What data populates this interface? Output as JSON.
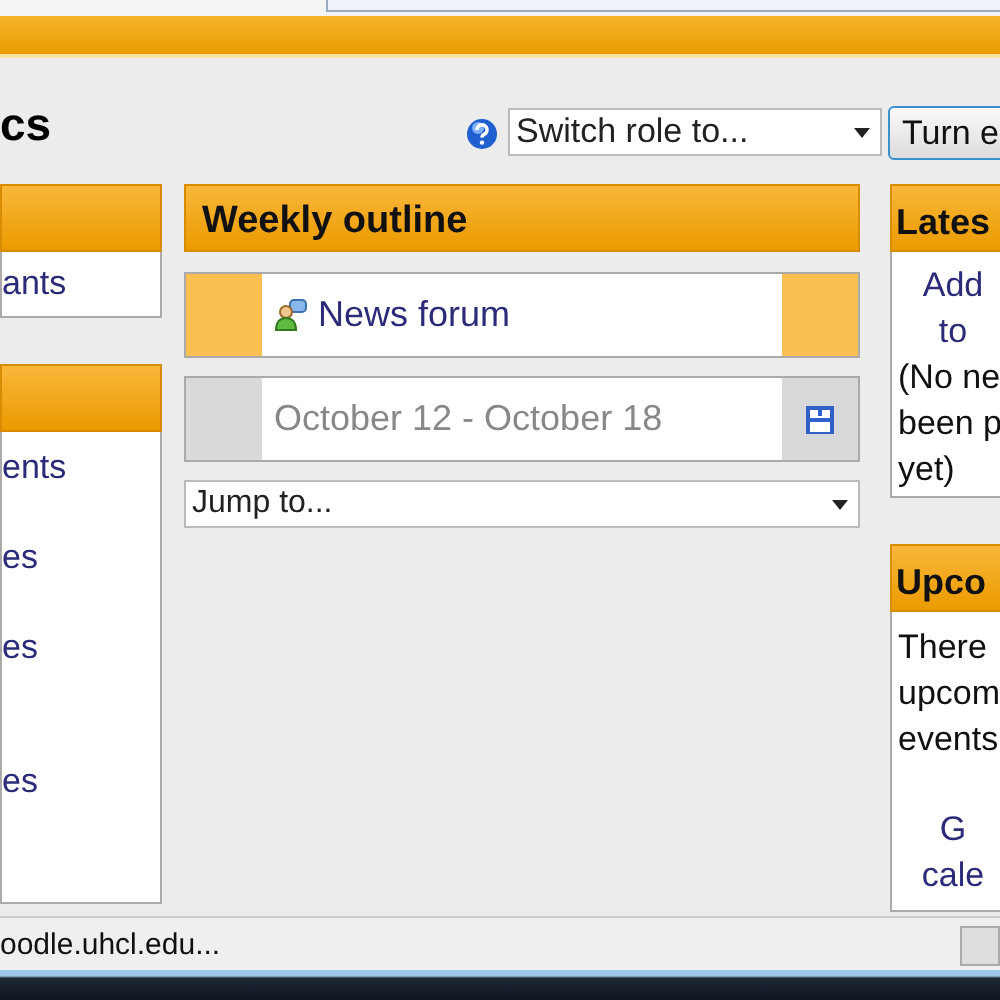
{
  "course_title": "cs",
  "role_select": {
    "value": "Switch role to..."
  },
  "edit_button": {
    "label": "Turn e"
  },
  "left_blocks": [
    {
      "items": [
        "ants"
      ]
    },
    {
      "items": [
        "ents",
        "es",
        "es",
        "es"
      ]
    }
  ],
  "center": {
    "title": "Weekly outline",
    "sections": [
      {
        "kind": "forum",
        "label": "News forum",
        "highlighted": true
      },
      {
        "kind": "week",
        "label": "October 12 - October 18",
        "highlighted": false
      }
    ],
    "jump_select": {
      "value": "Jump to..."
    }
  },
  "right_blocks": [
    {
      "title_lines": [
        "Lates"
      ],
      "lines": [
        {
          "kind": "link",
          "text": "Add"
        },
        {
          "kind": "link",
          "text": "to"
        },
        {
          "kind": "text",
          "text": "(No ne"
        },
        {
          "kind": "text",
          "text": "been p"
        },
        {
          "kind": "text",
          "text": "yet)"
        }
      ]
    },
    {
      "title_lines": [
        "Upco"
      ],
      "lines": [
        {
          "kind": "text",
          "text": "There"
        },
        {
          "kind": "text",
          "text": "upcom"
        },
        {
          "kind": "text",
          "text": "events"
        },
        {
          "kind": "link",
          "text": "G"
        },
        {
          "kind": "link",
          "text": "cale"
        }
      ]
    }
  ],
  "status_bar": {
    "text": "oodle.uhcl.edu..."
  }
}
